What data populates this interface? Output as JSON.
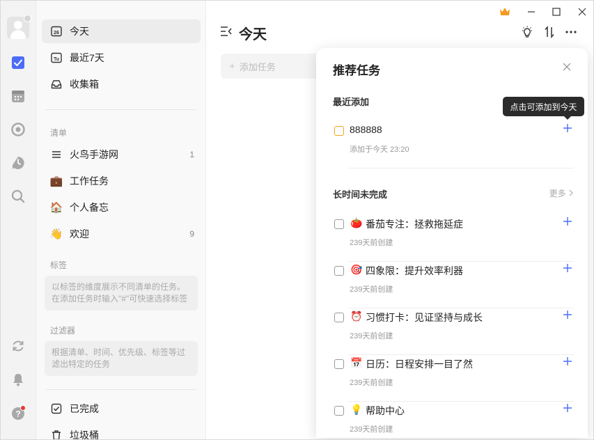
{
  "sidebar": {
    "nav": [
      {
        "label": "今天",
        "icon": "calendar-26-icon",
        "date_text": "26"
      },
      {
        "label": "最近7天",
        "icon": "calendar-week-icon",
        "date_text": "Tu"
      },
      {
        "label": "收集箱",
        "icon": "inbox-icon"
      }
    ],
    "lists_title": "清单",
    "lists": [
      {
        "label": "火鸟手游网",
        "icon": "list-icon",
        "count": "1"
      },
      {
        "label": "工作任务",
        "icon": "briefcase-icon",
        "emoji": "💼",
        "count": ""
      },
      {
        "label": "个人备忘",
        "icon": "house-icon",
        "emoji": "🏠",
        "count": ""
      },
      {
        "label": "欢迎",
        "icon": "waving-hand-icon",
        "emoji": "👋",
        "count": "9"
      }
    ],
    "tags_title": "标签",
    "tags_hint": "以标签的维度展示不同清单的任务。在添加任务时输入\"#\"可快速选择标签",
    "filters_title": "过滤器",
    "filters_hint": "根据清单、时间、优先级、标签等过滤出特定的任务",
    "completed": {
      "label": "已完成",
      "icon": "check-square-icon"
    },
    "trash": {
      "label": "垃圾桶",
      "icon": "trash-icon"
    }
  },
  "main": {
    "title": "今天",
    "add_task_placeholder": "添加任务"
  },
  "panel": {
    "title": "推荐任务",
    "recent_title": "最近添加",
    "recent_tasks": [
      {
        "title": "888888",
        "sub": "添加于今天 23:20"
      }
    ],
    "long_title": "长时间未完成",
    "more_label": "更多",
    "long_tasks": [
      {
        "emoji": "🍅",
        "icon": "tomato-icon",
        "title": "番茄专注：拯救拖延症",
        "sub": "239天前创建"
      },
      {
        "emoji": "🎯",
        "icon": "target-icon",
        "title": "四象限：提升效率利器",
        "sub": "239天前创建"
      },
      {
        "emoji": "⏰",
        "icon": "alarm-clock-icon",
        "title": "习惯打卡：见证坚持与成长",
        "sub": "239天前创建"
      },
      {
        "emoji": "📅",
        "icon": "calendar-icon",
        "title": "日历：日程安排一目了然",
        "sub": "239天前创建"
      },
      {
        "emoji": "💡",
        "icon": "lightbulb-icon",
        "title": "帮助中心",
        "sub": "239天前创建"
      }
    ],
    "tooltip": "点击可添加到今天"
  },
  "colors": {
    "accent": "#4a6cf7",
    "crown": "#f59a23",
    "orange_priority": "#f0a31c",
    "red_dot": "#e53935"
  }
}
